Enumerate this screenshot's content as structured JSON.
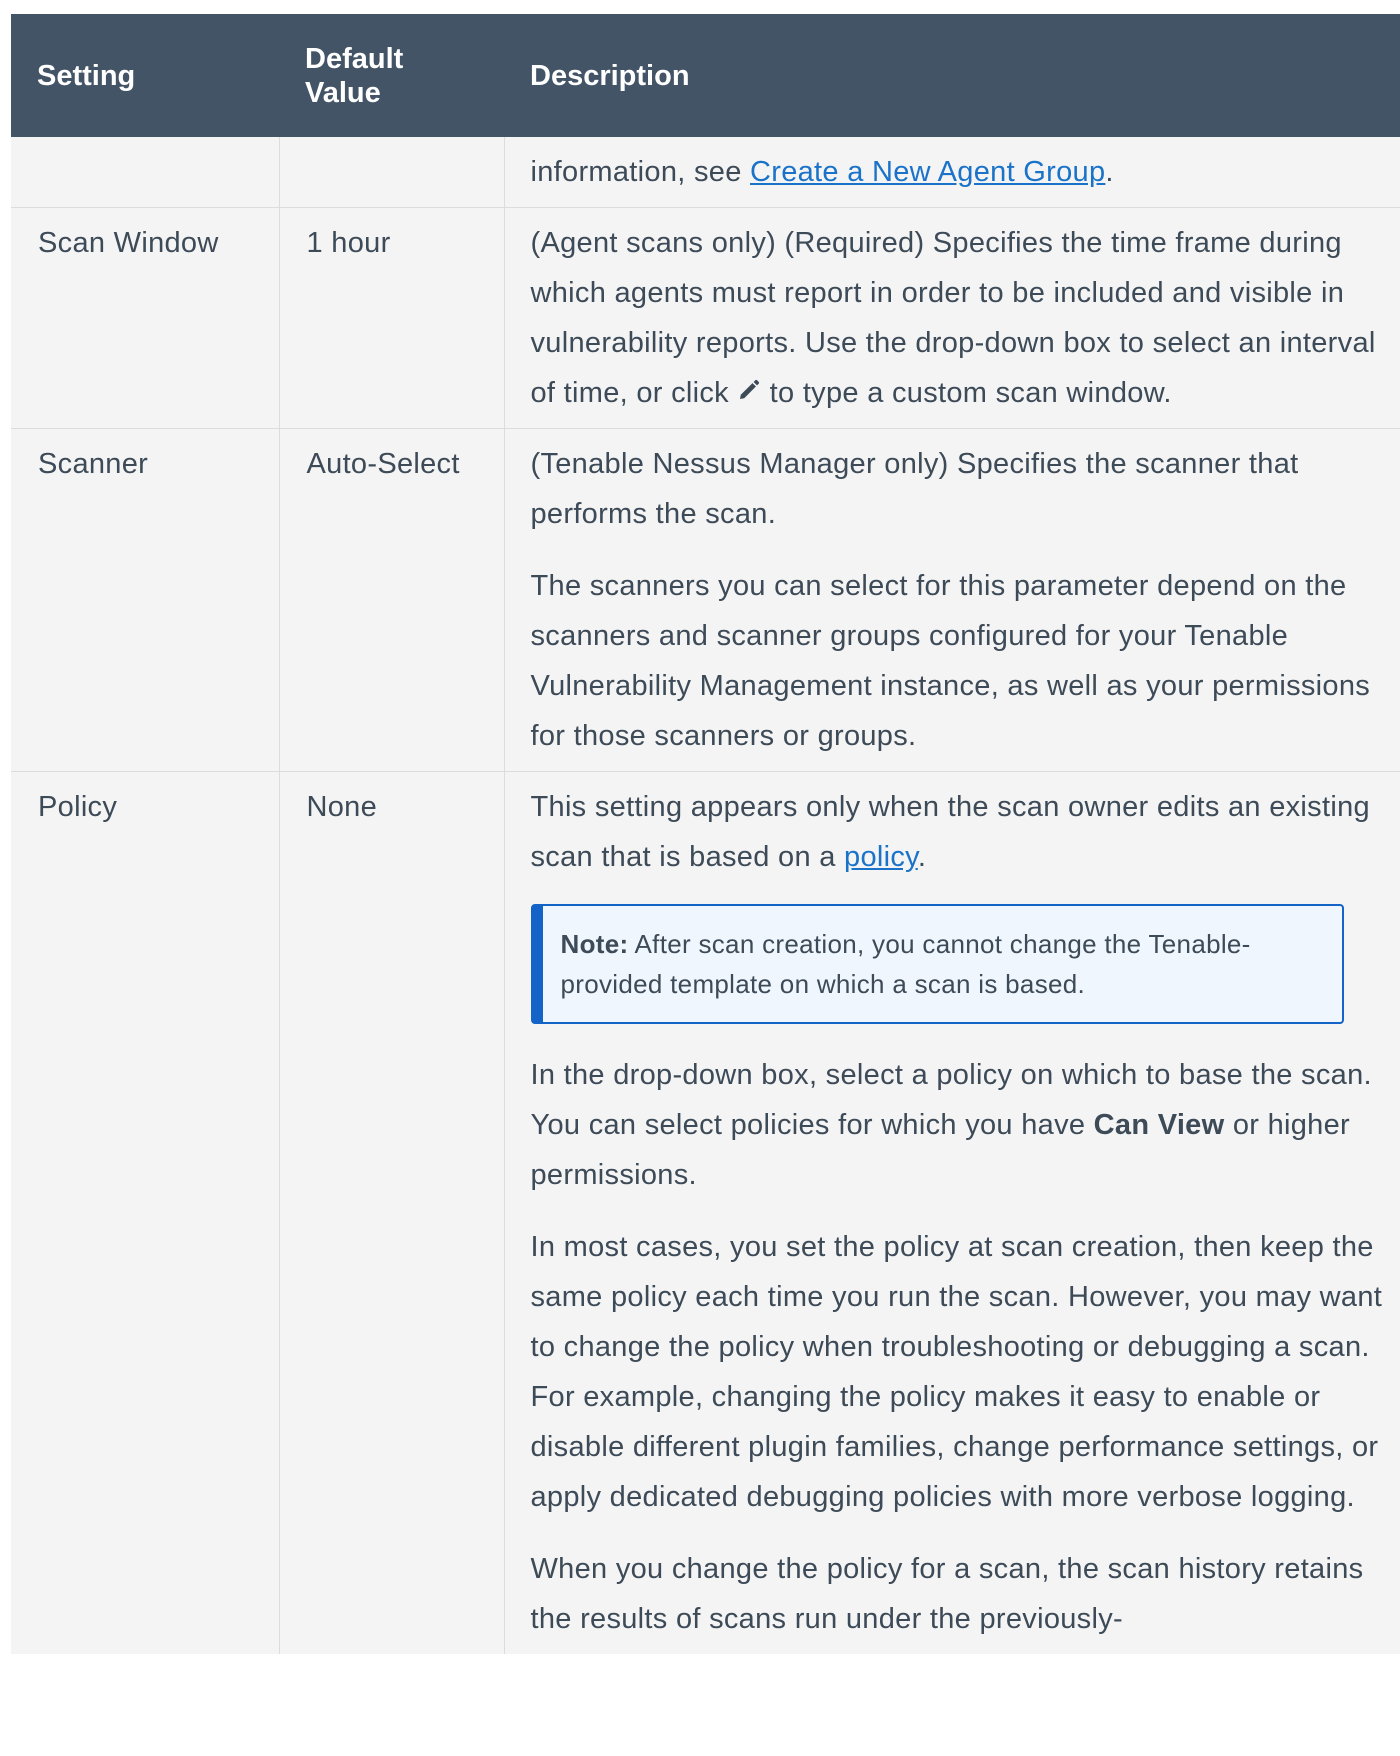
{
  "table": {
    "headers": [
      "Setting",
      "Default\nValue",
      "Description"
    ],
    "header_setting": "Setting",
    "header_default_line1": "Default",
    "header_default_line2": "Value",
    "header_description": "Description"
  },
  "row0": {
    "desc_prefix": "information, see ",
    "desc_link": "Create a New Agent Group",
    "desc_suffix": "."
  },
  "row_scan_window": {
    "setting": "Scan Window",
    "default": "1 hour",
    "desc_part1": "(Agent scans only) (Required) Specifies the time frame during which agents must report in order to be included and visible in vulnerability reports. Use the drop-down box to select an interval of time, or click ",
    "desc_icon": "pencil-icon",
    "desc_part2": " to type a custom scan window."
  },
  "row_scanner": {
    "setting": "Scanner",
    "default": "Auto-Select",
    "desc_p1": "(Tenable Nessus Manager only) Specifies the scanner that performs the scan.",
    "desc_p2": "The scanners you can select for this parameter depend on the scanners and scanner groups configured for your Tenable Vulnerability Management instance, as well as your permissions for those scanners or groups."
  },
  "row_policy": {
    "setting": "Policy",
    "default": "None",
    "desc_p1_prefix": "This setting appears only when the scan owner edits an existing scan that is based on a ",
    "desc_p1_link": "policy",
    "desc_p1_suffix": ".",
    "note_label": "Note:",
    "note_text": " After scan creation, you cannot change the Tenable-provided template on which a scan is based.",
    "desc_p2_prefix": "In the drop-down box, select a policy on which to base the scan. You can select policies for which you have ",
    "desc_p2_bold": "Can View",
    "desc_p2_suffix": " or higher permissions.",
    "desc_p3": "In most cases, you set the policy at scan creation, then keep the same policy each time you run the scan. However, you may want to change the policy when troubleshooting or debugging a scan. For example, changing the policy makes it easy to enable or disable different plugin families, change performance settings, or apply dedicated debugging policies with more verbose logging.",
    "desc_p4": "When you change the policy for a scan, the scan history retains the results of scans run under the previously-"
  },
  "colors": {
    "header_bg": "#425466",
    "cell_bg": "#f4f4f4",
    "link": "#1a73c8",
    "note_border": "#1463c6",
    "note_bg": "#f0f6fd"
  }
}
